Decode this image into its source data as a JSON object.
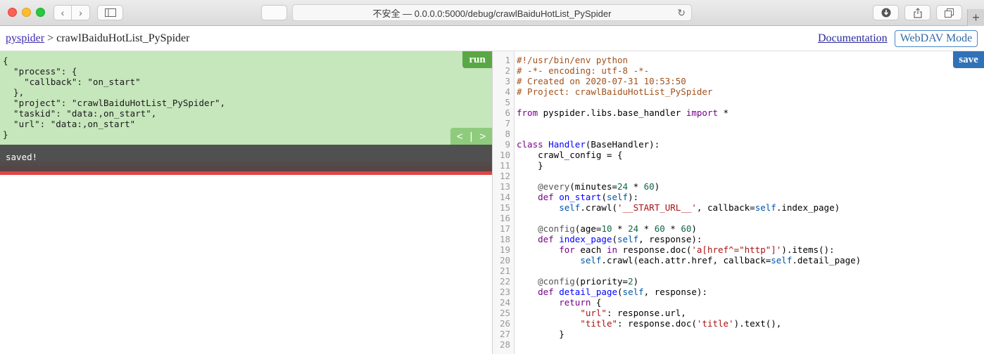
{
  "browser": {
    "url": "不安全 — 0.0.0.0:5000/debug/crawlBaiduHotList_PySpider"
  },
  "header": {
    "breadcrumb_root": "pyspider",
    "breadcrumb_sep": ">",
    "project_name": "crawlBaiduHotList_PySpider",
    "documentation_link": "Documentation",
    "webdav_button": "WebDAV Mode"
  },
  "task_panel": {
    "run_label": "run",
    "pager_prev": "<",
    "pager_sep": "|",
    "pager_next": ">",
    "lines": [
      "{",
      "  \"process\": {",
      "    \"callback\": \"on_start\"",
      "  },",
      "  \"project\": \"crawlBaiduHotList_PySpider\",",
      "  \"taskid\": \"data:,on_start\",",
      "  \"url\": \"data:,on_start\"",
      "}"
    ],
    "message": "saved!"
  },
  "editor": {
    "save_label": "save",
    "lines": [
      "#!/usr/bin/env python",
      "# -*- encoding: utf-8 -*-",
      "# Created on 2020-07-31 10:53:50",
      "# Project: crawlBaiduHotList_PySpider",
      "",
      "from pyspider.libs.base_handler import *",
      "",
      "",
      "class Handler(BaseHandler):",
      "    crawl_config = {",
      "    }",
      "",
      "    @every(minutes=24 * 60)",
      "    def on_start(self):",
      "        self.crawl('__START_URL__', callback=self.index_page)",
      "",
      "    @config(age=10 * 24 * 60 * 60)",
      "    def index_page(self, response):",
      "        for each in response.doc('a[href^=\"http\"]').items():",
      "            self.crawl(each.attr.href, callback=self.detail_page)",
      "",
      "    @config(priority=2)",
      "    def detail_page(self, response):",
      "        return {",
      "            \"url\": response.url,",
      "            \"title\": response.doc('title').text(),",
      "        }",
      ""
    ]
  }
}
